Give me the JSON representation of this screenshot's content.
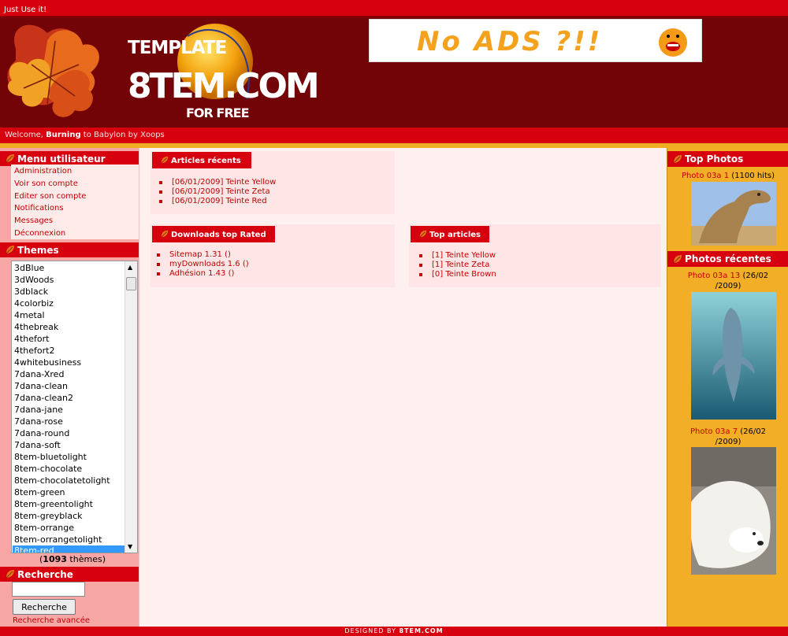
{
  "topbar": {
    "text": "Just Use it!"
  },
  "header": {
    "logo_template": "TEMPLATE",
    "logo_main": "8TEM.COM",
    "logo_sub": "FOR FREE",
    "ad_text": "No ADS ?!!"
  },
  "welcome": {
    "prefix": "Welcome,",
    "user": "Burning",
    "suffix": "to Babylon by Xoops"
  },
  "user_menu": {
    "title": "Menu utilisateur",
    "items": [
      "Administration",
      "Voir son compte",
      "Editer son compte",
      "Notifications",
      "Messages",
      "Déconnexion"
    ]
  },
  "themes": {
    "title": "Themes",
    "items": [
      "3dBlue",
      "3dWoods",
      "3dblack",
      "4colorbiz",
      "4metal",
      "4thebreak",
      "4thefort",
      "4thefort2",
      "4whitebusiness",
      "7dana-Xred",
      "7dana-clean",
      "7dana-clean2",
      "7dana-jane",
      "7dana-rose",
      "7dana-round",
      "7dana-soft",
      "8tem-bluetolight",
      "8tem-chocolate",
      "8tem-chocolatetolight",
      "8tem-green",
      "8tem-greentolight",
      "8tem-greyblack",
      "8tem-orrange",
      "8tem-orrangetolight",
      "8tem-red"
    ],
    "selected": "8tem-red",
    "count": "1093",
    "count_suffix": "thèmes"
  },
  "search": {
    "title": "Recherche",
    "value": "",
    "button": "Recherche",
    "advanced": "Recherche avancée"
  },
  "articles_recents": {
    "title": "Articles récents",
    "items": [
      "[06/01/2009] Teinte Yellow",
      "[06/01/2009] Teinte Zeta",
      "[06/01/2009] Teinte Red"
    ]
  },
  "downloads": {
    "title": "Downloads top Rated",
    "items": [
      "Sitemap 1.31 ()",
      "myDownloads 1.6 ()",
      "Adhésion 1.43 ()"
    ]
  },
  "top_articles": {
    "title": "Top articles",
    "items": [
      "[1] Teinte Yellow",
      "[1] Teinte Zeta",
      "[0] Teinte Brown"
    ]
  },
  "top_photos": {
    "title": "Top Photos",
    "photo_link": "Photo 03a 1",
    "photo_hits": "(1100 hits)",
    "photo_icon": "camel-photo"
  },
  "photos_recentes": {
    "title": "Photos récentes",
    "items": [
      {
        "link": "Photo 03a 13",
        "date_a": "(26/02",
        "date_b": "/2009)",
        "icon": "dolphin-photo"
      },
      {
        "link": "Photo 03a 7",
        "date_a": "(26/02",
        "date_b": "/2009)",
        "icon": "polar-bear-photo"
      }
    ]
  },
  "footer": {
    "prefix": "DESIGNED BY",
    "brand": "8TEM.COM"
  },
  "colors": {
    "red": "#d6000f",
    "dark_red": "#720306",
    "gold": "#efad24",
    "pink": "#f7a6a6",
    "link": "#c00000"
  }
}
